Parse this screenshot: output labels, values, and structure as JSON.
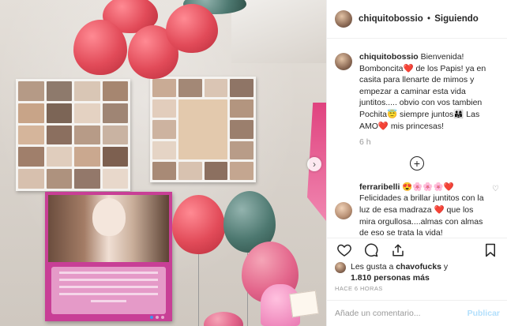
{
  "header": {
    "username": "chiquitobossio",
    "separator": "•",
    "follow_status": "Siguiendo"
  },
  "caption": {
    "username": "chiquitobossio",
    "text": "Bienvenida! Bomboncita❤️ de los Papis! ya en casita para llenarte de mimos y empezar a caminar esta vida juntitos..... obvio con vos tambien Pochita😇 siempre juntos👨‍👩‍👧 Las AMO❤️ mis princesas!",
    "time": "6 h"
  },
  "load_more": {
    "icon": "plus-circle-icon",
    "glyph": "+"
  },
  "comment": {
    "username": "ferraribelli",
    "text": "😍🌸🌸🌸❤️ Felicidades a brillar juntitos con la luz de esa madraza ❤️ que los mira orgullosa....almas con almas de eso se trata la vida!",
    "like_glyph": "♡"
  },
  "likes": {
    "prefix": "Les gusta a ",
    "user": "chavofucks",
    "middle": " y",
    "count": "1.810 personas más"
  },
  "date": "HACE 6 HORAS",
  "add_comment": {
    "placeholder": "Añade un comentario...",
    "publish": "Publicar"
  },
  "carousel": {
    "next_glyph": "›",
    "slide_count": 3,
    "active_slide": 1
  },
  "colors": {
    "link_blue": "#3897f0",
    "publish_disabled": "#b2dffc",
    "muted": "#999999"
  }
}
